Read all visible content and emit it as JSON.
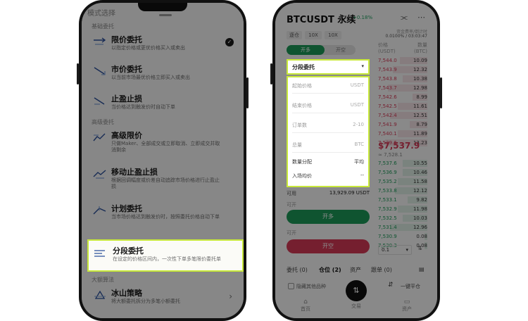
{
  "left_panel": {
    "status_text": "模式选择",
    "section_basic": "基础委托",
    "section_advanced": "高级委托",
    "section_algo": "大额算法",
    "orders": [
      {
        "title": "限价委托",
        "desc": "以指定价格或更优价格买入或卖出",
        "selected": true
      },
      {
        "title": "市价委托",
        "desc": "以当前市场最优价格立即买入或卖出"
      },
      {
        "title": "止盈止损",
        "desc": "当价格达到触发价时自动下单"
      },
      {
        "title": "高级限价",
        "desc": "只做Maker、全部成交或立即取消、立即成交并取消剩余"
      },
      {
        "title": "移动止盈止损",
        "desc": "根据回调幅度或价差自动追踪市场价格进行止盈止损"
      },
      {
        "title": "计划委托",
        "desc": "当市场价格达到触发价时，按照委托价格自动下单"
      },
      {
        "title": "分段委托",
        "desc": "在设定的价格区间内，一次性下单多笔限价委托单",
        "highlighted": true
      },
      {
        "title": "冰山策略",
        "desc": "将大额委托拆分为多笔小额委托"
      }
    ]
  },
  "right_panel": {
    "pair": "BTCUSDT 永续",
    "change": "+0.18%",
    "leverage": [
      "逐仓",
      "10X",
      "10X"
    ],
    "funding_label": "资金费率/倒计时",
    "funding_value": "0.0100% / 03:03:47",
    "buy_tab": "开多",
    "sell_tab": "开空",
    "order_type": "分段委托",
    "fields": [
      {
        "label": "起始价格",
        "unit": "USDT"
      },
      {
        "label": "结束价格",
        "unit": "USDT"
      },
      {
        "label": "订单数",
        "unit": "2-10"
      },
      {
        "label": "总量",
        "unit": "BTC"
      },
      {
        "label": "数量分配",
        "unit": "平均"
      },
      {
        "label": "入场均价",
        "unit": "--"
      }
    ],
    "avail_label": "可用",
    "avail_value": "13,929.09 USDT",
    "open_label": "可开",
    "open_label2": "可开",
    "buy_btn": "开多",
    "sell_btn": "开空",
    "ob_price_header": "价格",
    "ob_price_unit": "(USDT)",
    "ob_qty_header": "数量",
    "ob_qty_unit": "(BTC)",
    "asks": [
      {
        "p": "7,544.0",
        "q": "10.09",
        "w": 0.55
      },
      {
        "p": "7,543.9",
        "q": "12.32",
        "w": 0.7
      },
      {
        "p": "7,543.8",
        "q": "10.38",
        "w": 0.5
      },
      {
        "p": "7,543.7",
        "q": "12.98",
        "w": 0.8
      },
      {
        "p": "7,542.6",
        "q": "8.99",
        "w": 0.3
      },
      {
        "p": "7,542.5",
        "q": "11.61",
        "w": 0.6
      },
      {
        "p": "7,542.4",
        "q": "12.51",
        "w": 0.75
      },
      {
        "p": "7,541.9",
        "q": "8.79",
        "w": 0.35
      },
      {
        "p": "7,540.1",
        "q": "11.89",
        "w": 0.6
      },
      {
        "p": "7,539.6",
        "q": "13.23",
        "w": 0.85
      }
    ],
    "mid_price": "$7,537.9",
    "mid_sub": "≈ 7,528.1",
    "bids": [
      {
        "p": "7,537.6",
        "q": "10.55",
        "w": 0.5
      },
      {
        "p": "7,536.9",
        "q": "10.46",
        "w": 0.5
      },
      {
        "p": "7,535.2",
        "q": "11.58",
        "w": 0.6
      },
      {
        "p": "7,533.8",
        "q": "12.12",
        "w": 0.65
      },
      {
        "p": "7,533.1",
        "q": "9.82",
        "w": 0.4
      },
      {
        "p": "7,532.9",
        "q": "11.98",
        "w": 0.6
      },
      {
        "p": "7,532.5",
        "q": "10.03",
        "w": 0.5
      },
      {
        "p": "7,531.4",
        "q": "12.96",
        "w": 0.75
      },
      {
        "p": "7,530.9",
        "q": "0.08",
        "w": 0.05
      },
      {
        "p": "7,530.3",
        "q": "0.08",
        "w": 0.05
      }
    ],
    "depth_value": "0.1",
    "tabs": [
      "委托 (0)",
      "仓位 (2)",
      "资产",
      "跟单 (0)"
    ],
    "hide_other": "隐藏其他品种",
    "close_all": "一键平仓",
    "nav": [
      "首页",
      "交易",
      "资产"
    ],
    "colors": {
      "buy": "#1c9a58",
      "sell": "#d63a57",
      "highlight": "#c8e83a"
    }
  }
}
